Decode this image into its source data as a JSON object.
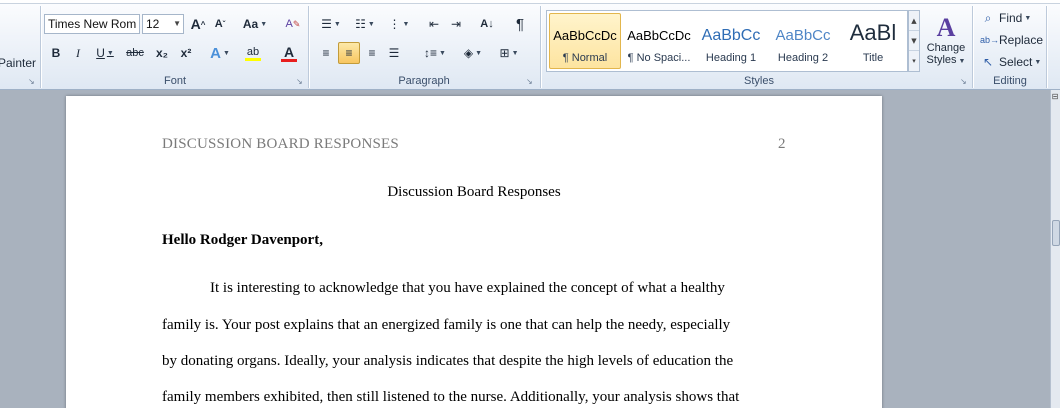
{
  "clipboard": {
    "format_painter_label": "Painter"
  },
  "font": {
    "group_label": "Font",
    "font_name": "Times New Rom",
    "font_size": "12",
    "grow_glyph": "A",
    "shrink_glyph": "A",
    "case_glyph": "Aa",
    "clear_glyph": "A",
    "bold": "B",
    "italic": "I",
    "underline": "U",
    "strike": "abc",
    "subscript": "x₂",
    "superscript": "x²",
    "effects_glyph": "A",
    "highlight_glyph": "ab",
    "color_glyph": "A"
  },
  "paragraph": {
    "group_label": "Paragraph",
    "pilcrow": "¶",
    "sort_glyph": "A↓"
  },
  "styles": {
    "group_label": "Styles",
    "tiles": [
      {
        "preview": "AaBbCcDc",
        "name": "¶ Normal"
      },
      {
        "preview": "AaBbCcDc",
        "name": "¶ No Spaci..."
      },
      {
        "preview": "AaBbCc",
        "name": "Heading 1"
      },
      {
        "preview": "AaBbCc",
        "name": "Heading 2"
      },
      {
        "preview": "AaBl",
        "name": "Title"
      }
    ],
    "change_styles_line1": "Change",
    "change_styles_line2": "Styles"
  },
  "editing": {
    "group_label": "Editing",
    "find_label": "Find",
    "replace_label": "Replace",
    "select_label": "Select"
  },
  "document": {
    "header": "DISCUSSION BOARD RESPONSES",
    "page_number": "2",
    "title": "Discussion Board Responses",
    "greeting": "Hello Rodger Davenport,",
    "lines": [
      "It is interesting to acknowledge that you have explained the concept of what a healthy",
      "family is.  Your post explains that an energized family is one that can help the needy, especially",
      "by donating organs. Ideally, your analysis indicates that despite the high levels  of education the",
      "family members exhibited, then still listened to the nurse.  Additionally, your analysis  shows that"
    ]
  },
  "colors": {
    "accent_highlight": "#f8c660",
    "font_color_bar": "#e81e1e",
    "highlight_bar": "#ffff00",
    "heading_blue": "#2f6db5"
  }
}
